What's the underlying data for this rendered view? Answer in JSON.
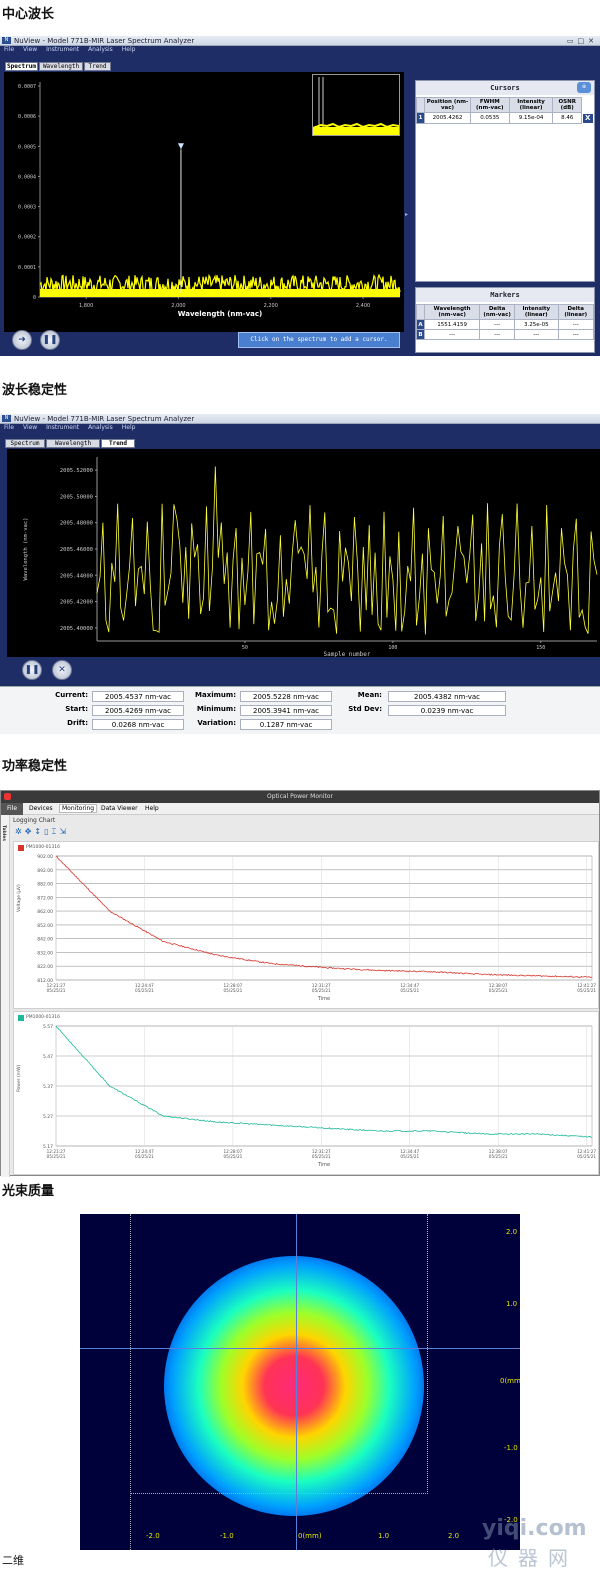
{
  "headings": {
    "center_wavelength": "中心波长",
    "wavelength_stability": "波长稳定性",
    "power_stability": "功率稳定性",
    "beam_quality": "光束质量",
    "two_d": "二维"
  },
  "spectrum_window": {
    "title": "NuView - Model 771B-MIR Laser Spectrum Analyzer",
    "menu": [
      "File",
      "View",
      "Instrument",
      "Analysis",
      "Help"
    ],
    "tabs": [
      "Spectrum",
      "Wavelength",
      "Trend"
    ],
    "active_tab": "Spectrum",
    "y_ticks": [
      "0.0007",
      "0.0006",
      "0.0005",
      "0.0004",
      "0.0003",
      "0.0002",
      "0.0001",
      "0"
    ],
    "x_ticks": [
      "1,800",
      "2,000",
      "2,200",
      "2,400"
    ],
    "x_label": "Wavelength (nm-vac)",
    "hint": "Click on the spectrum to add a cursor.",
    "cursors": {
      "title": "Cursors",
      "headers": [
        "Position (nm-vac)",
        "FWHM (nm-vac)",
        "Intensity (linear)",
        "OSNR (dB)"
      ],
      "rows": [
        {
          "id": "1",
          "position": "2005.4262",
          "fwhm": "0.0535",
          "intensity": "9.15e-04",
          "osnr": "8.46"
        }
      ]
    },
    "markers": {
      "title": "Markers",
      "headers": [
        "Wavelength (nm-vac)",
        "Delta (nm-vac)",
        "Intensity (linear)",
        "Delta (linear)"
      ],
      "rows": [
        {
          "id": "A",
          "wavelength": "1551.4159",
          "delta": "---",
          "intensity": "3.25e-05",
          "delta_lin": "---"
        },
        {
          "id": "B",
          "wavelength": "---",
          "delta": "---",
          "intensity": "---",
          "delta_lin": "---"
        }
      ]
    }
  },
  "trend_window": {
    "title": "NuView - Model 771B-MIR Laser Spectrum Analyzer",
    "menu": [
      "File",
      "View",
      "Instrument",
      "Analysis",
      "Help"
    ],
    "tabs": [
      "Spectrum",
      "Wavelength",
      "Trend"
    ],
    "active_tab": "Trend",
    "y_label": "Wavelength (nm-vac)",
    "x_label": "Sample number",
    "stats": {
      "current_label": "Current:",
      "current": "2005.4537 nm-vac",
      "maximum_label": "Maximum:",
      "maximum": "2005.5228 nm-vac",
      "mean_label": "Mean:",
      "mean": "2005.4382 nm-vac",
      "start_label": "Start:",
      "start": "2005.4269 nm-vac",
      "minimum_label": "Minimum:",
      "minimum": "2005.3941 nm-vac",
      "stddev_label": "Std Dev:",
      "stddev": "0.0239 nm-vac",
      "drift_label": "Drift:",
      "drift": "0.0268 nm-vac",
      "variation_label": "Variation:",
      "variation": "0.1287 nm-vac"
    }
  },
  "power_window": {
    "title": "Optical Power Monitor",
    "menu": [
      "File",
      "Devices",
      "Monitoring",
      "Data Viewer",
      "Help"
    ],
    "side_tab": "Tables",
    "panel_title": "Logging Chart",
    "chart1_legend": "PM1000-01316",
    "chart1_ylabel": "Voltage (μV)",
    "chart1_yticks": [
      "902.00",
      "892.00",
      "882.00",
      "872.00",
      "862.00",
      "852.00",
      "842.00",
      "832.00",
      "822.00",
      "812.00"
    ],
    "chart2_legend": "PM1000-01316",
    "chart2_ylabel": "Power (mW)",
    "chart2_yticks": [
      "5.57",
      "5.47",
      "5.37",
      "5.27",
      "5.17"
    ],
    "x_ticks": [
      "12:21:27\n05/25/21",
      "12:24:47\n05/25/21",
      "12:28:07\n05/25/21",
      "12:31:27\n05/25/21",
      "12:34:47\n05/25/21",
      "12:38:07\n05/25/21",
      "12:41:27\n05/25/21"
    ],
    "x_label": "Time",
    "colors": {
      "chart1": "#d9342b",
      "chart2": "#1fb89a"
    }
  },
  "beam": {
    "y_ticks": [
      "2.0",
      "1.0",
      "0(mm)",
      "-1.0",
      "-2.0"
    ],
    "x_ticks": [
      "-2.0",
      "-1.0",
      "0(mm)",
      "1.0",
      "2.0"
    ]
  },
  "chart_data": [
    {
      "type": "line",
      "title": "",
      "xlabel": "Wavelength (nm-vac)",
      "ylabel": "",
      "xlim": [
        1700,
        2480
      ],
      "ylim": [
        0,
        0.0007
      ],
      "x": [
        1700,
        1800,
        1900,
        2000,
        2005.4,
        2010,
        2100,
        2200,
        2300,
        2400,
        2480
      ],
      "y": [
        2e-05,
        2e-05,
        2e-05,
        2e-05,
        0.00049,
        2e-05,
        2e-05,
        2e-05,
        2e-05,
        2e-05,
        2e-05
      ],
      "color": "#ffff00"
    },
    {
      "type": "line",
      "title": "",
      "xlabel": "Sample number",
      "ylabel": "Wavelength (nm-vac)",
      "ylim": [
        2005.39,
        2005.53
      ],
      "x_ticks": [
        50,
        100,
        150
      ],
      "y_ticks": [
        "2005.52000",
        "2005.50000",
        "2005.48000",
        "2005.46000",
        "2005.44000",
        "2005.42000",
        "2005.40000"
      ],
      "color": "#ffff33"
    },
    {
      "type": "line",
      "title": "",
      "xlabel": "Time",
      "ylabel": "Voltage (μV)",
      "ylim": [
        812,
        902
      ],
      "series": [
        {
          "name": "PM1000-01316",
          "values": [
            902,
            862,
            840,
            830,
            824,
            821,
            819,
            818,
            816,
            815,
            814
          ]
        }
      ]
    },
    {
      "type": "line",
      "title": "",
      "xlabel": "Time",
      "ylabel": "Power (mW)",
      "ylim": [
        5.17,
        5.57
      ],
      "series": [
        {
          "name": "PM1000-01316",
          "values": [
            5.57,
            5.37,
            5.27,
            5.25,
            5.24,
            5.23,
            5.22,
            5.22,
            5.21,
            5.21,
            5.2
          ]
        }
      ]
    }
  ]
}
